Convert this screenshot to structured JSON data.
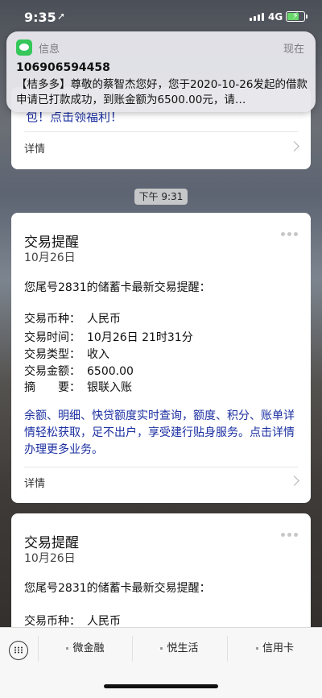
{
  "status": {
    "time": "9:35",
    "network": "4G"
  },
  "notification": {
    "app": "信息",
    "when": "现在",
    "sender": "106906594458",
    "message": "【桔多多】尊敬的蔡智杰您好，您于2020-10-26发起的借款申请已打款成功，到账金额为6500.00元，请…"
  },
  "prev_card": {
    "promo_tail": "包！点击领福利！",
    "detail": "详情"
  },
  "timestamp": "下午 9:31",
  "card1": {
    "title": "交易提醒",
    "date": "10月26日",
    "intro": "您尾号2831的储蓄卡最新交易提醒：",
    "fields": [
      {
        "k": "交易币种：",
        "v": "人民币"
      },
      {
        "k": "交易时间：",
        "v": "10月26日 21时31分"
      },
      {
        "k": "交易类型：",
        "v": "收入"
      },
      {
        "k": "交易金额：",
        "v": "6500.00"
      },
      {
        "k": "摘　　要：",
        "v": "银联入账"
      }
    ],
    "links": "余额、明细、快贷额度实时查询，额度、积分、账单详情轻松获取，足不出户，享受建行贴身服务。点击详情办理更多业务。",
    "detail": "详情"
  },
  "card2": {
    "title": "交易提醒",
    "date": "10月26日",
    "intro": "您尾号2831的储蓄卡最新交易提醒：",
    "field1": {
      "k": "交易币种：",
      "v": "人民币"
    }
  },
  "menu": [
    "微金融",
    "悦生活",
    "信用卡"
  ]
}
